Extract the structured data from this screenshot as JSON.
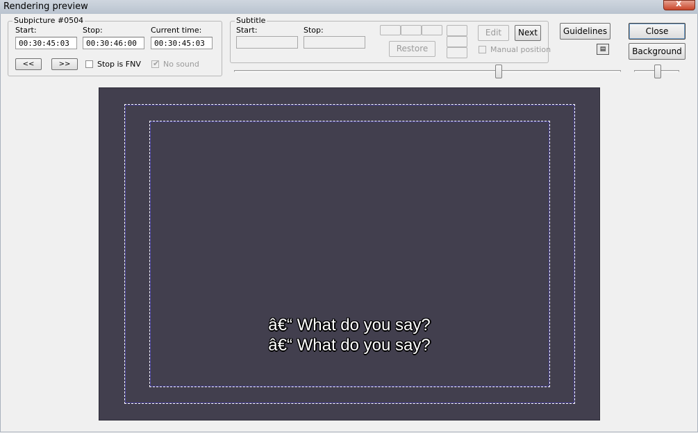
{
  "window": {
    "title": "Rendering preview",
    "close_symbol": "x"
  },
  "subpicture": {
    "legend": "Subpicture #0504",
    "start_label": "Start:",
    "stop_label": "Stop:",
    "current_label": "Current time:",
    "start_value": "00:30:45:03",
    "stop_value": "00:30:46:00",
    "current_value": "00:30:45:03",
    "prev_label": "<<",
    "next_label": ">>",
    "stop_fnv_label": "Stop is FNV",
    "no_sound_label": "No sound"
  },
  "subtitle": {
    "legend": "Subtitle",
    "start_label": "Start:",
    "stop_label": "Stop:",
    "start_value": "",
    "stop_value": "",
    "edit_label": "Edit",
    "next_label": "Next",
    "restore_label": "Restore",
    "manual_position_label": "Manual position"
  },
  "buttons": {
    "guidelines": "Guidelines",
    "close": "Close",
    "background": "Background"
  },
  "preview": {
    "line1": "â€“ What do you say?",
    "line2": "â€“ What do you say?",
    "background_color": "#423f4e"
  }
}
